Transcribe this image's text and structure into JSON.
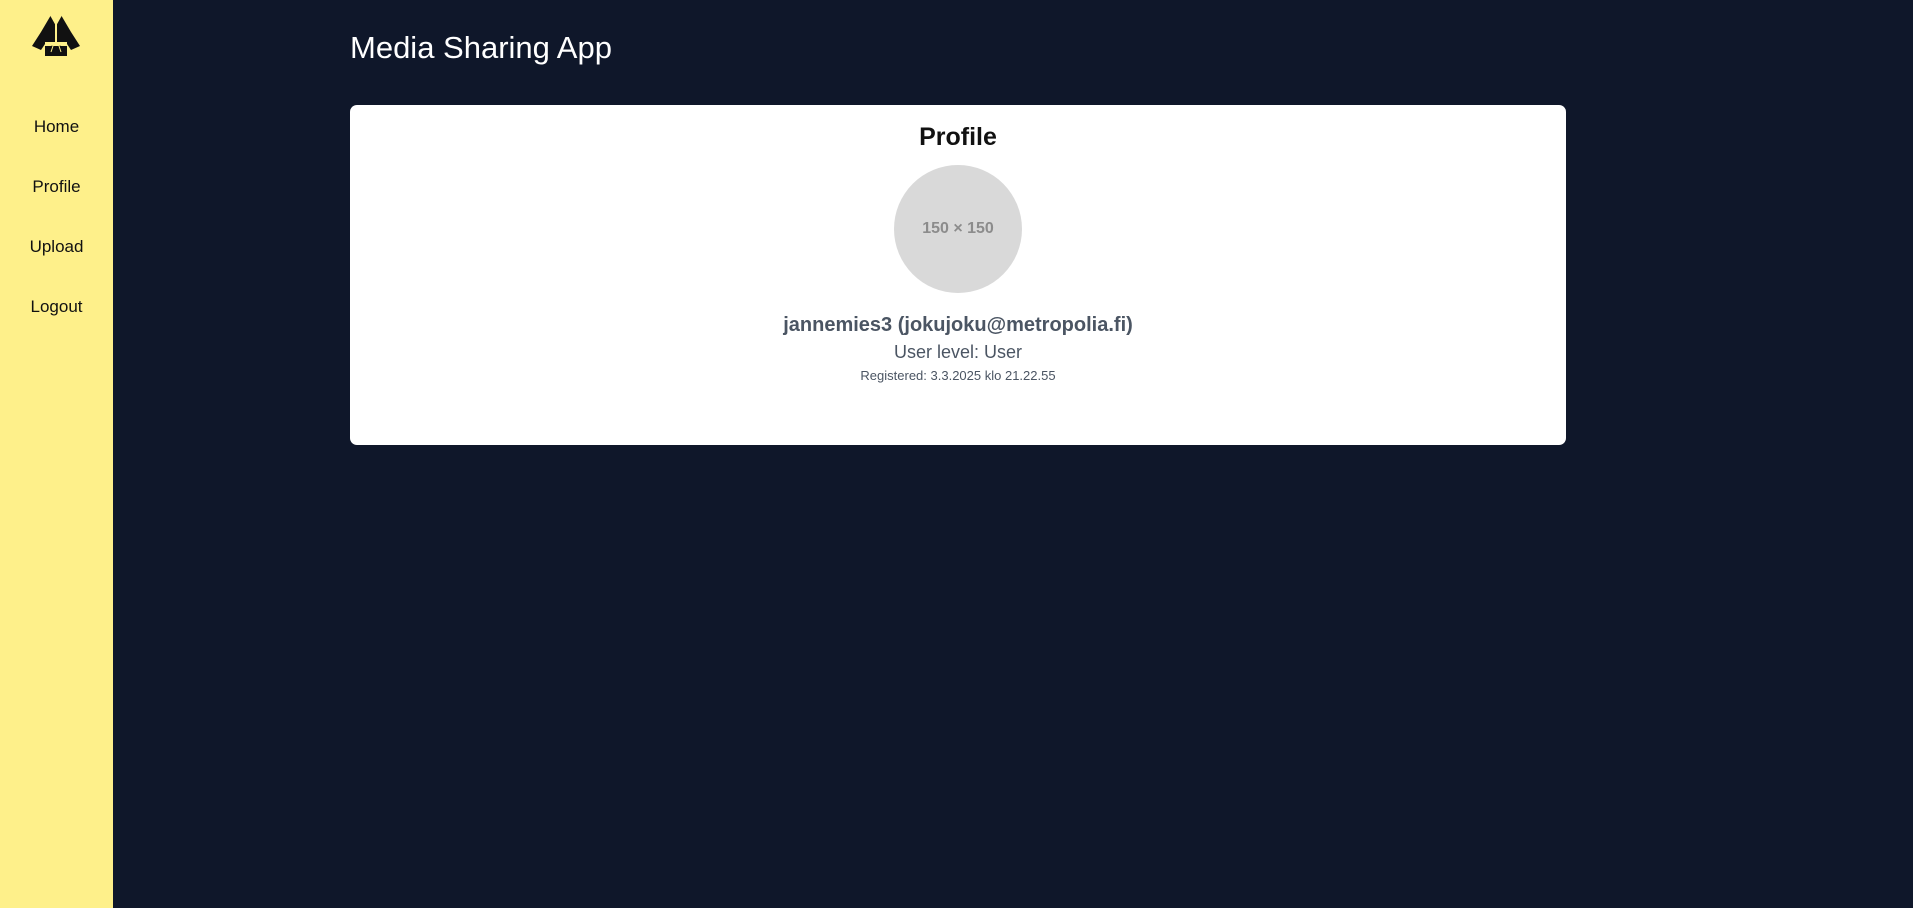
{
  "app": {
    "title": "Media Sharing App"
  },
  "sidebar": {
    "logo_icon": "karate-gi-icon",
    "background_color": "#fef08a",
    "items": [
      {
        "label": "Home"
      },
      {
        "label": "Profile"
      },
      {
        "label": "Upload"
      },
      {
        "label": "Logout"
      }
    ]
  },
  "profile": {
    "heading": "Profile",
    "avatar_placeholder": "150 × 150",
    "user_line": "jannemies3 (jokujoku@metropolia.fi)",
    "level_line": "User level: User",
    "registered_line": "Registered: 3.3.2025 klo 21.22.55"
  },
  "colors": {
    "page_background": "#0f172a",
    "card_background": "#ffffff",
    "muted_text": "#4b5563"
  }
}
